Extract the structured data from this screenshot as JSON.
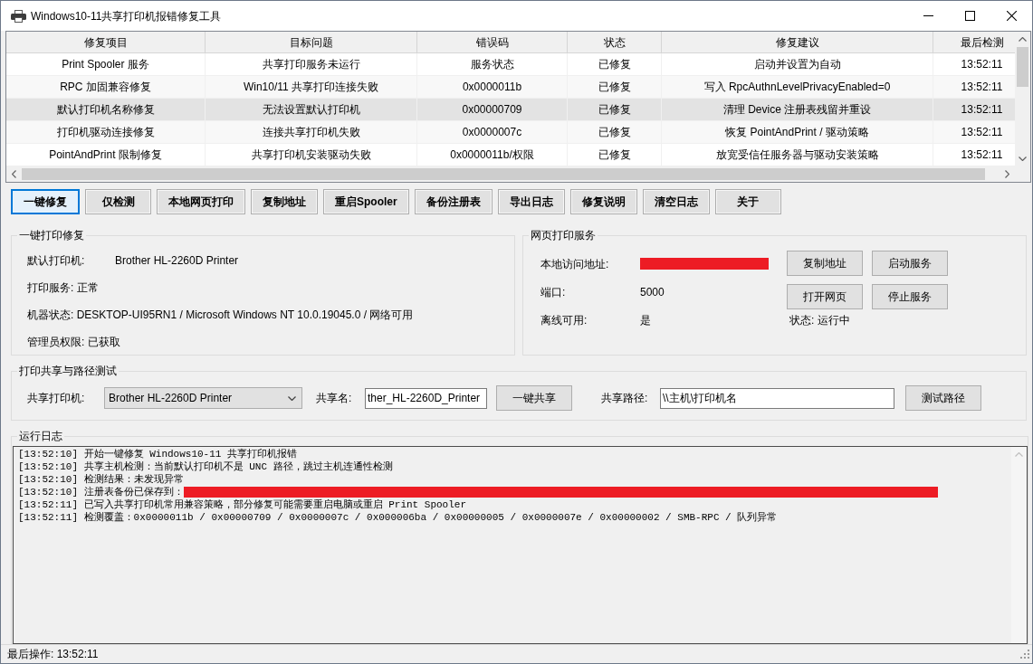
{
  "window": {
    "title": "Windows10-11共享打印机报错修复工具"
  },
  "table": {
    "columns": [
      "修复项目",
      "目标问题",
      "错误码",
      "状态",
      "修复建议",
      "最后检测"
    ],
    "rows": [
      {
        "cells": [
          "Print Spooler 服务",
          "共享打印服务未运行",
          "服务状态",
          "已修复",
          "启动并设置为自动",
          "13:52:11"
        ],
        "selected": false
      },
      {
        "cells": [
          "RPC 加固兼容修复",
          "Win10/11 共享打印连接失败",
          "0x0000011b",
          "已修复",
          "写入 RpcAuthnLevelPrivacyEnabled=0",
          "13:52:11"
        ],
        "selected": false
      },
      {
        "cells": [
          "默认打印机名称修复",
          "无法设置默认打印机",
          "0x00000709",
          "已修复",
          "清理 Device 注册表残留并重设",
          "13:52:11"
        ],
        "selected": true
      },
      {
        "cells": [
          "打印机驱动连接修复",
          "连接共享打印机失败",
          "0x0000007c",
          "已修复",
          "恢复 PointAndPrint / 驱动策略",
          "13:52:11"
        ],
        "selected": false
      },
      {
        "cells": [
          "PointAndPrint 限制修复",
          "共享打印机安装驱动失败",
          "0x0000011b/权限",
          "已修复",
          "放宽受信任服务器与驱动安装策略",
          "13:52:11"
        ],
        "selected": false
      }
    ]
  },
  "toolbar": [
    {
      "label": "一键修复",
      "focused": true
    },
    {
      "label": "仅检测",
      "focused": false
    },
    {
      "label": "本地网页打印",
      "focused": false
    },
    {
      "label": "复制地址",
      "focused": false
    },
    {
      "label": "重启Spooler",
      "focused": false
    },
    {
      "label": "备份注册表",
      "focused": false
    },
    {
      "label": "导出日志",
      "focused": false
    },
    {
      "label": "修复说明",
      "focused": false
    },
    {
      "label": "清空日志",
      "focused": false
    },
    {
      "label": "关于",
      "focused": false
    }
  ],
  "repair_panel": {
    "title": "一键打印修复",
    "fields": [
      {
        "kind": "pair",
        "label": "默认打印机:",
        "value": "Brother HL-2260D Printer"
      },
      {
        "kind": "text",
        "label": "打印服务: 正常"
      },
      {
        "kind": "text",
        "label": "机器状态: DESKTOP-UI95RN1 / Microsoft Windows NT 10.0.19045.0 / 网络可用"
      },
      {
        "kind": "text",
        "label": "管理员权限: 已获取"
      }
    ]
  },
  "web_service": {
    "title": "网页打印服务",
    "fields": [
      {
        "label": "本地访问地址:",
        "redacted": true
      },
      {
        "label": "端口:",
        "value": "5000",
        "redacted": false
      },
      {
        "label": "离线可用:",
        "value": "是",
        "redacted": false
      }
    ],
    "buttons": [
      "复制地址",
      "启动服务",
      "打开网页",
      "停止服务"
    ],
    "status": "状态: 运行中"
  },
  "share_panel": {
    "title": "打印共享与路径测试",
    "printer_label": "共享打印机:",
    "printer_value": "Brother HL-2260D Printer",
    "share_name_label": "共享名:",
    "share_name_value": "ther_HL-2260D_Printer",
    "share_button": "一键共享",
    "path_label": "共享路径:",
    "path_value": "\\\\主机\\打印机名",
    "test_button": "测试路径"
  },
  "log": {
    "title": "运行日志",
    "lines": [
      {
        "text": "[13:52:10] 开始一键修复 Windows10-11 共享打印机报错",
        "redacted": false
      },
      {
        "text": "[13:52:10] 共享主机检测：当前默认打印机不是 UNC 路径，跳过主机连通性检测",
        "redacted": false
      },
      {
        "text": "[13:52:10] 检测结果：未发现异常",
        "redacted": false
      },
      {
        "text": "[13:52:10] 注册表备份已保存到：",
        "redacted": true
      },
      {
        "text": "[13:52:11] 已写入共享打印机常用兼容策略，部分修复可能需要重启电脑或重启 Print Spooler",
        "redacted": false
      },
      {
        "text": "[13:52:11] 检测覆盖：0x0000011b / 0x00000709 / 0x0000007c / 0x000006ba / 0x00000005 / 0x0000007e / 0x00000002 / SMB-RPC / 队列异常",
        "redacted": false
      }
    ]
  },
  "status_bar": {
    "text": "最后操作: 13:52:11"
  }
}
